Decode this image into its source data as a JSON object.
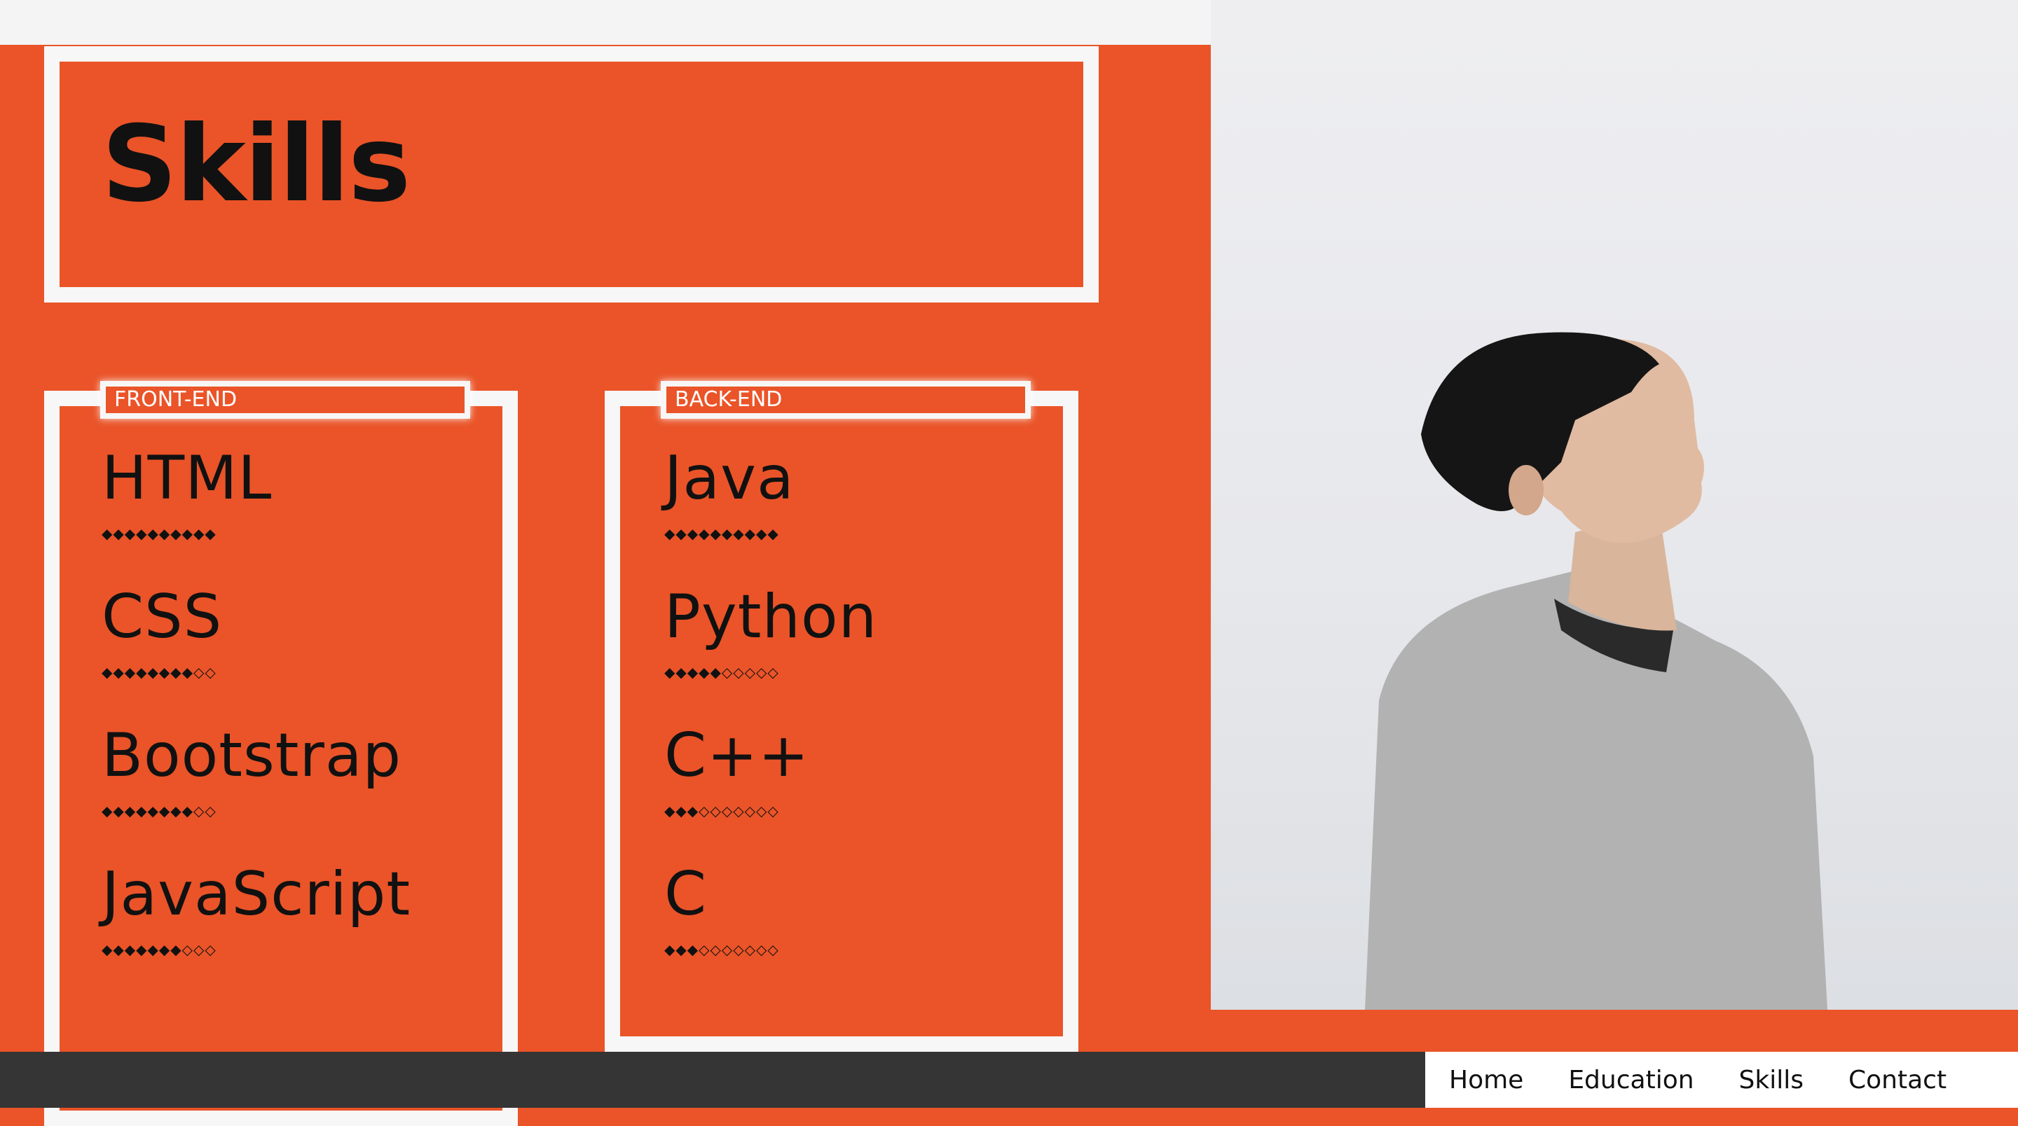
{
  "page": {
    "title": "Skills",
    "accent_color": "#ea5428"
  },
  "frontend": {
    "label": "FRONT-END",
    "skills": [
      {
        "name": "HTML",
        "rating": 10,
        "max": 10
      },
      {
        "name": "CSS",
        "rating": 8,
        "max": 10
      },
      {
        "name": "Bootstrap",
        "rating": 8,
        "max": 10
      },
      {
        "name": "JavaScript",
        "rating": 7,
        "max": 10
      }
    ]
  },
  "backend": {
    "label": "BACK-END",
    "skills": [
      {
        "name": "Java",
        "rating": 10,
        "max": 10
      },
      {
        "name": "Python",
        "rating": 5,
        "max": 10
      },
      {
        "name": "C++",
        "rating": 3,
        "max": 10
      },
      {
        "name": "C",
        "rating": 3,
        "max": 10
      }
    ]
  },
  "nav": {
    "items": [
      "Home",
      "Education",
      "Skills",
      "Contact"
    ]
  }
}
